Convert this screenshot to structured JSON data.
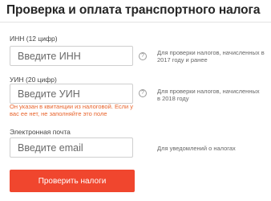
{
  "page": {
    "title": "Проверка и оплата транспортного налога"
  },
  "inn": {
    "label": "ИНН (12 цифр)",
    "placeholder": "Введите ИНН",
    "value": "",
    "help_icon": "?",
    "hint": "Для проверки налогов, начисленных в 2017 году и ранее"
  },
  "uin": {
    "label": "УИН (20 цифр)",
    "placeholder": "Введите УИН",
    "value": "",
    "help_icon": "?",
    "hint": "Для проверки налогов, начисленных в 2018 году",
    "warning": "Он указан в квитанции из налоговой. Если у вас ее нет, не заполняйте это поле"
  },
  "email": {
    "label": "Электронная почта",
    "placeholder": "Введите email",
    "value": "",
    "hint": "Для уведомлений о налогах"
  },
  "submit": {
    "label": "Проверить налоги"
  },
  "colors": {
    "accent": "#f0462e",
    "warning": "#e8632b"
  }
}
